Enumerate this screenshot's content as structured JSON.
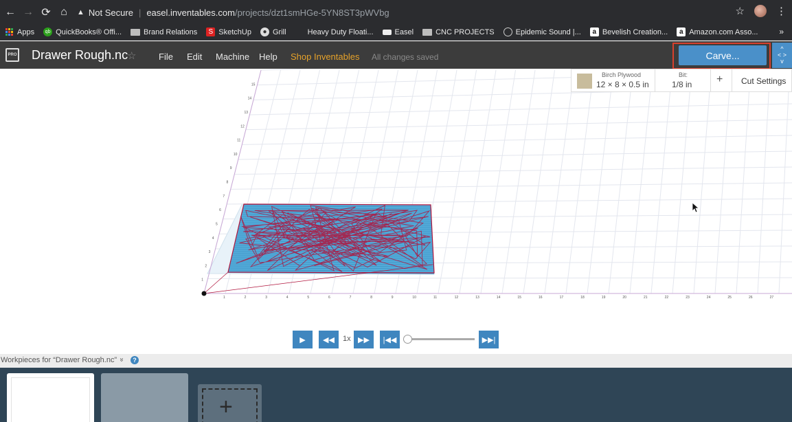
{
  "browser": {
    "security_label": "Not Secure",
    "url_host": "easel.inventables.com",
    "url_path": "/projects/dzt1smHGe-5YN8ST3pWVbg",
    "bookmarks": [
      {
        "label": "Apps",
        "icon": "apps-grid-icon"
      },
      {
        "label": "QuickBooks® Offi...",
        "icon": "quickbooks-icon"
      },
      {
        "label": "Brand Relations",
        "icon": "folder-icon"
      },
      {
        "label": "SketchUp",
        "icon": "sketchup-icon"
      },
      {
        "label": "Grill",
        "icon": "globe-icon"
      },
      {
        "label": "Heavy Duty Floati...",
        "icon": "blank-icon"
      },
      {
        "label": "Easel",
        "icon": "easel-icon"
      },
      {
        "label": "CNC PROJECTS",
        "icon": "folder-icon"
      },
      {
        "label": "Epidemic Sound |...",
        "icon": "epidemic-icon"
      },
      {
        "label": "Bevelish Creation...",
        "icon": "amazon-icon"
      },
      {
        "label": "Amazon.com Asso...",
        "icon": "amazon-icon"
      }
    ],
    "more_label": "»"
  },
  "app": {
    "logo_text": "PRO",
    "project_title": "Drawer Rough.nc",
    "menu": [
      "File",
      "Edit",
      "Machine",
      "Help"
    ],
    "shop_label": "Shop Inventables",
    "save_status": "All changes saved",
    "carve_label": "Carve...",
    "expand_label": "< >"
  },
  "workpiece": {
    "material_name": "Birch Plywood",
    "material_size": "12 × 8 × 0.5 in",
    "bit_label": "Bit:",
    "bit_value": "1/8 in",
    "add_label": "+",
    "cut_settings_label": "Cut Settings"
  },
  "canvas": {
    "x_ticks": [
      "1",
      "2",
      "3",
      "4",
      "5",
      "6",
      "7",
      "8",
      "9",
      "10",
      "11",
      "12",
      "13",
      "14",
      "15",
      "16",
      "17",
      "18",
      "19",
      "20",
      "21",
      "22",
      "23",
      "24",
      "25",
      "26",
      "27"
    ],
    "y_ticks": [
      "1",
      "2",
      "3",
      "4",
      "5",
      "6",
      "7",
      "8",
      "9",
      "10",
      "11",
      "12",
      "13",
      "14",
      "15"
    ]
  },
  "transport": {
    "speed_label": "1x"
  },
  "bottom": {
    "workpieces_label": "Workpieces for “Drawer Rough.nc”",
    "chevron": "»",
    "help": "?"
  },
  "colors": {
    "accent": "#4a90c9",
    "toolpath": "#b0143c",
    "material_fill": "#4aa3d6",
    "highlight": "#d9402c",
    "shop": "#e6a22a"
  }
}
